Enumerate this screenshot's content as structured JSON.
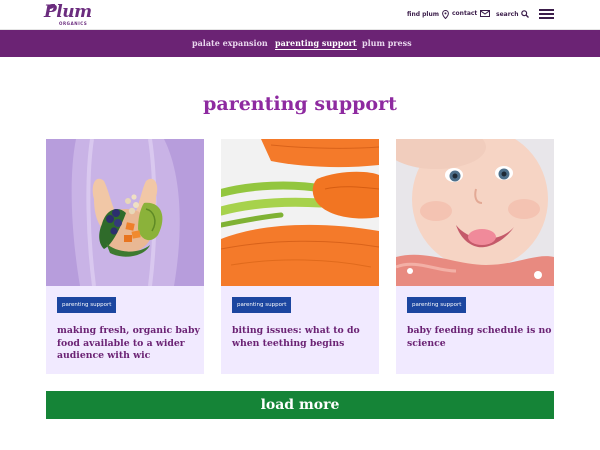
{
  "header": {
    "logo": {
      "text": "Plum",
      "subtext": "ORGANICS"
    },
    "utility": {
      "find_plum": "find plum",
      "contact": "contact",
      "search": "search"
    },
    "icons": {
      "find_plum": "map-pin-icon",
      "contact": "envelope-icon",
      "search": "search-icon",
      "menu": "hamburger-menu-icon"
    }
  },
  "subnav": {
    "items": [
      {
        "label": "palate expansion",
        "active": false
      },
      {
        "label": "parenting support",
        "active": true
      },
      {
        "label": "plum press",
        "active": false
      }
    ]
  },
  "main": {
    "title": "parenting support",
    "cards": [
      {
        "tag": "parenting support",
        "title": "making fresh, organic baby food available to a wider audience with wic",
        "image": "hands-holding-vegetables"
      },
      {
        "tag": "parenting support",
        "title": "biting issues: what to do when teething begins",
        "image": "carrots"
      },
      {
        "tag": "parenting support",
        "title": "baby feeding schedule is no science",
        "image": "smiling-baby"
      }
    ],
    "load_more": "load more"
  },
  "colors": {
    "brand_purple": "#6b2374",
    "title_purple": "#8e2aa0",
    "card_bg": "#f1eaff",
    "badge_blue": "#1c46a0",
    "load_more_green": "#158437"
  }
}
